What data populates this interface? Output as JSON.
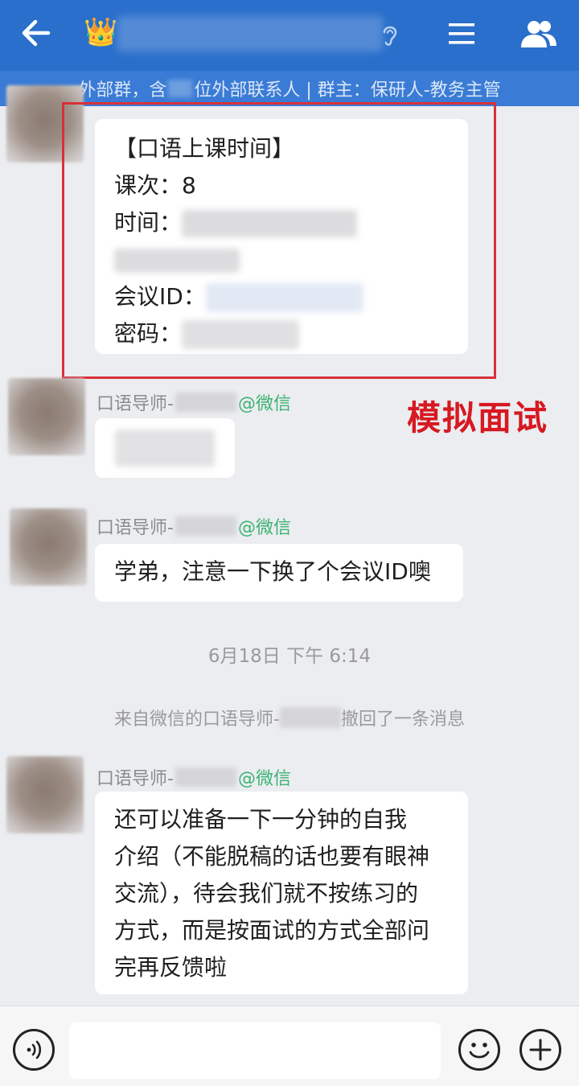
{
  "header": {
    "crown_emoji": "👑",
    "group_name_hidden": "",
    "subtitle_prefix": "外部群，含",
    "subtitle_suffix": "位外部联系人 | 群主：保研人-教务主管"
  },
  "messages": [
    {
      "card": {
        "title": "【口语上课时间】",
        "session_label": "课次：",
        "session_value": "8",
        "time_label": "时间：",
        "meeting_id_label": "会议ID：",
        "password_label": "密码："
      }
    },
    {
      "sender_prefix": "口语导师-",
      "sender_suffix": "@微信"
    },
    {
      "sender_prefix": "口语导师-",
      "sender_suffix": "@微信",
      "text": "学弟，注意一下换了个会议ID噢"
    },
    {
      "sender_prefix": "口语导师-",
      "sender_suffix": "@微信",
      "text_lines": [
        "还可以准备一下一分钟的自我",
        "介绍（不能脱稿的话也要有眼神",
        "交流），待会我们就不按练习的",
        "方式，而是按面试的方式全部问",
        "完再反馈啦"
      ]
    }
  ],
  "system": {
    "timestamp": "6月18日  下午 6:14",
    "recall_prefix": "来自微信的口语导师-",
    "recall_suffix": "撤回了一条消息"
  },
  "annotation": {
    "stamp_text": "模拟面试",
    "box_color": "#d9303a",
    "stamp_color": "#d71921"
  },
  "input": {
    "placeholder": ""
  },
  "colors": {
    "header": "#2a6fcb",
    "subbar": "#3a7bd5",
    "wechat_tag": "#3cb371",
    "background": "#ebedf0"
  }
}
